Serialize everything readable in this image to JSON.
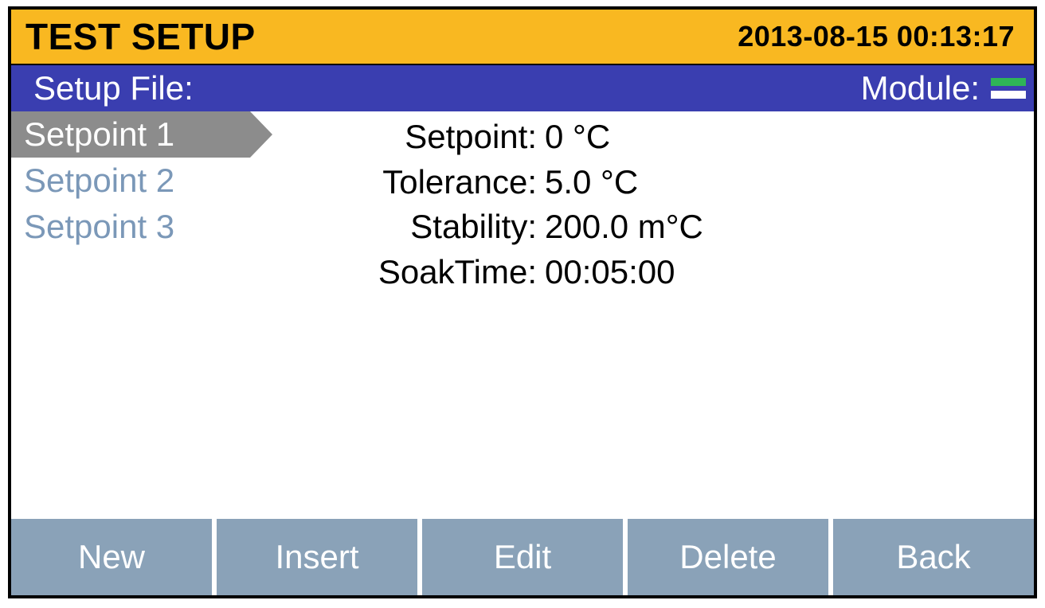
{
  "header": {
    "title": "TEST SETUP",
    "timestamp": "2013-08-15 00:13:17"
  },
  "subheader": {
    "setup_file_label": "Setup File:",
    "module_label": "Module:"
  },
  "setpoints": {
    "items": [
      {
        "label": "Setpoint 1",
        "selected": true
      },
      {
        "label": "Setpoint 2",
        "selected": false
      },
      {
        "label": "Setpoint 3",
        "selected": false
      }
    ]
  },
  "details": {
    "setpoint_label": "Setpoint:",
    "setpoint_value": "0 °C",
    "tolerance_label": "Tolerance:",
    "tolerance_value": "5.0 °C",
    "stability_label": "Stability:",
    "stability_value": "200.0 m°C",
    "soaktime_label": "SoakTime:",
    "soaktime_value": "00:05:00"
  },
  "footer": {
    "new": "New",
    "insert": "Insert",
    "edit": "Edit",
    "delete": "Delete",
    "back": "Back"
  }
}
